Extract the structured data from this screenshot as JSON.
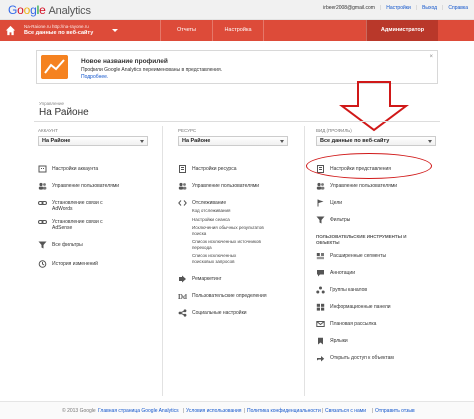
{
  "topbar": {
    "logo_google": [
      "G",
      "o",
      "o",
      "g",
      "l",
      "e"
    ],
    "logo_product": "Analytics",
    "user": "irbeer2008@gmail.com",
    "settings_link": "Настройки",
    "logout_link": "Выход",
    "help_link": "Справка"
  },
  "nav": {
    "account_url": "Na-Raione.ru http://na-rayone.ru",
    "profile": "Все данные по веб-сайту",
    "reports_tab": "Отчеты",
    "settings_tab": "Настройка",
    "admin_tab": "Администратор"
  },
  "notice": {
    "title": "Новое название профилей",
    "body": "Профили Google Analytics переименованы в представления.",
    "more": "Подробнее."
  },
  "admin": {
    "breadcrumb": "Управление",
    "title": "На Районе"
  },
  "account": {
    "header": "АККАУНТ",
    "selected": "На Районе",
    "items": [
      "Настройки аккаунта",
      "Управление пользователями",
      "Установление связи с AdWords",
      "Установление связи с AdSense",
      "Все фильтры",
      "История изменений"
    ]
  },
  "property": {
    "header": "РЕСУРС",
    "selected": "На Районе",
    "items": [
      "Настройки ресурса",
      "Управление пользователями"
    ],
    "tracking": "Отслеживание",
    "tracking_sub": [
      "Код отслеживания",
      "Настройки сеанса",
      "Исключения обычных результатов поиска",
      "Список исключенных источников перехода",
      "Список исключенных поисковых запросов"
    ],
    "items2": [
      "Ремаркетинг",
      "Пользовательские определения",
      "Социальные настройки"
    ]
  },
  "view": {
    "header": "ВИД (ПРОФИЛЬ)",
    "selected": "Все данные по веб-сайту",
    "items": [
      "Настройки представления",
      "Управление пользователями",
      "Цели",
      "Фильтры"
    ],
    "section": "ПОЛЬЗОВАТЕЛЬСКИЕ ИНСТРУМЕНТЫ И ОБЪЕКТЫ",
    "tools": [
      "Расширенные сегменты",
      "Аннотации",
      "Группы каналов",
      "Информационные панели",
      "Плановая рассылка",
      "Ярлыки",
      "Открыть доступ к объектам"
    ]
  },
  "footer": {
    "copyright": "© 2013 Google",
    "links": [
      "Главная страница Google Analytics",
      "Условия использования",
      "Политика конфиденциальности",
      "Связаться с нами",
      "Отправить отзыв"
    ]
  },
  "colors": {
    "nav_red": "#dd4b39",
    "admin_tab": "#b9382a",
    "notice_orange": "#f58220",
    "highlight_oval": "#d01818",
    "link_blue": "#1155cc"
  }
}
